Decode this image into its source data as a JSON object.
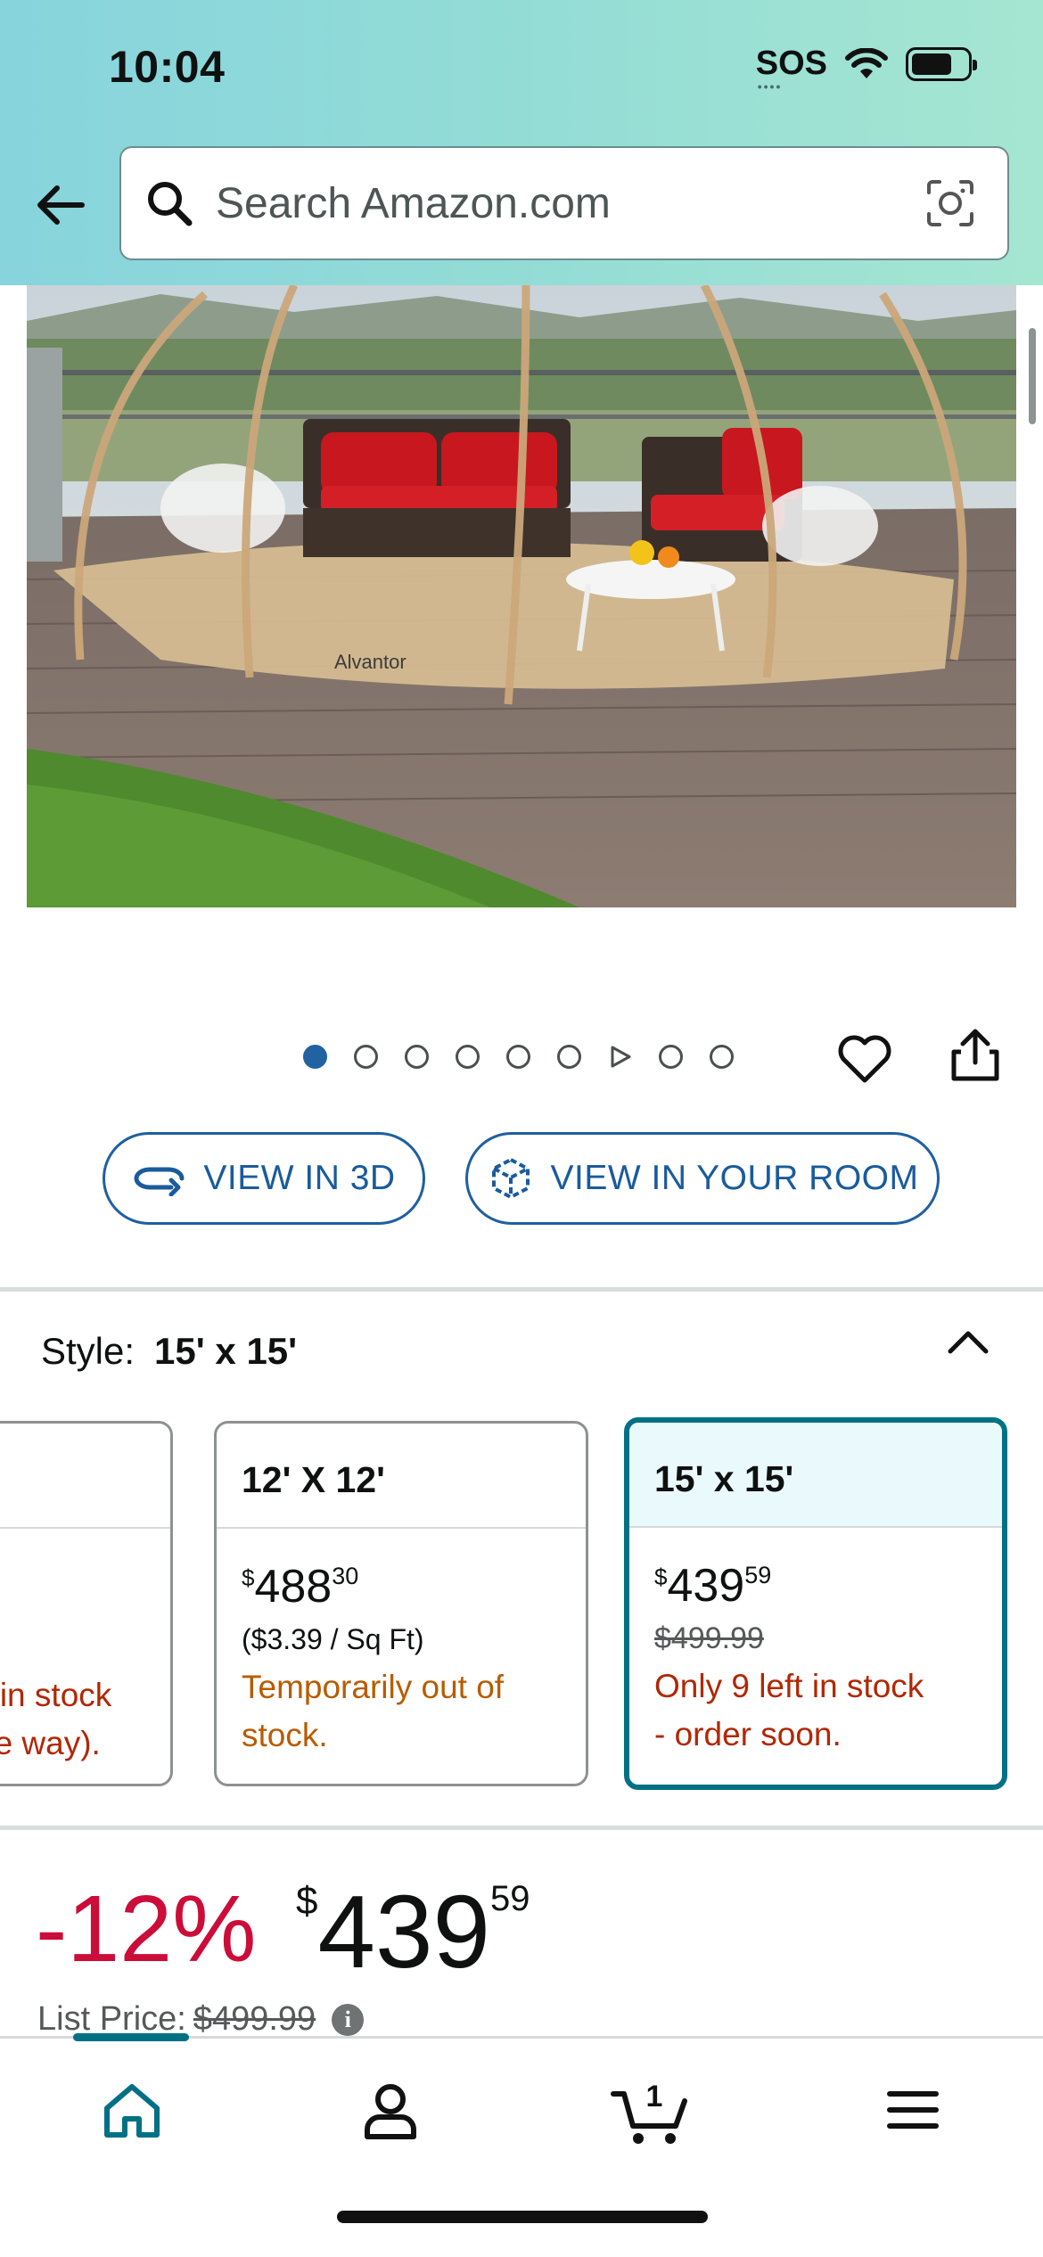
{
  "status_bar": {
    "time": "10:04",
    "sos": "SOS",
    "sos_dots": "••••"
  },
  "search": {
    "placeholder": "Search Amazon.com"
  },
  "product_image": {
    "brand_text": "Alvantor"
  },
  "carousel": {
    "total_items": 9,
    "active_index": 0,
    "video_index": 6
  },
  "view_buttons": {
    "view_3d": "VIEW IN 3D",
    "view_room": "VIEW IN YOUR ROOM"
  },
  "style": {
    "label": "Style:",
    "selected": "15' x 15'"
  },
  "variants": [
    {
      "title": "",
      "stock": "ft in stock",
      "stock2": "ne way)."
    },
    {
      "title": "12' X 12'",
      "price_symbol": "$",
      "price_whole": "488",
      "price_fraction": "30",
      "unit_price": "($3.39 / Sq Ft)",
      "stock": "Temporarily out of",
      "stock2": "stock."
    },
    {
      "title": "15' x 15'",
      "price_symbol": "$",
      "price_whole": "439",
      "price_fraction": "59",
      "list_price": "$499.99",
      "stock": "Only 9 left in stock",
      "stock2": "- order soon."
    }
  ],
  "price": {
    "discount": "-12%",
    "symbol": "$",
    "whole": "439",
    "fraction": "59",
    "list_label": "List Price:",
    "list_value": "$499.99",
    "info": "i"
  },
  "cart": {
    "count": "1"
  },
  "colors": {
    "accent": "#007185",
    "link": "#1f5fa1",
    "deal": "#cc0c39",
    "low_stock": "#b12704",
    "out_of_stock": "#b85c00"
  }
}
